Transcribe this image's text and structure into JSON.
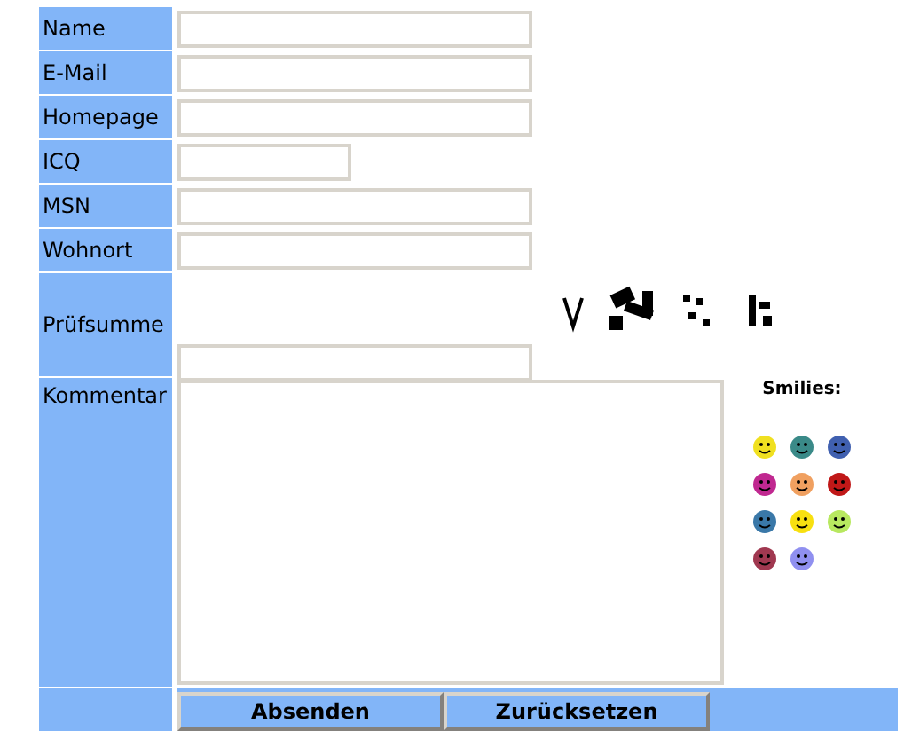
{
  "fields": [
    {
      "label": "Name",
      "kind": "text"
    },
    {
      "label": "E-Mail",
      "kind": "text"
    },
    {
      "label": "Homepage",
      "kind": "text"
    },
    {
      "label": "ICQ",
      "kind": "short"
    },
    {
      "label": "MSN",
      "kind": "text"
    },
    {
      "label": "Wohnort",
      "kind": "text"
    },
    {
      "label": "Prüfsumme",
      "kind": "captcha"
    }
  ],
  "comment": {
    "label": "Kommentar"
  },
  "smilies": {
    "title": "Smilies:",
    "items": [
      {
        "color": "#f0e020"
      },
      {
        "color": "#3a8a88"
      },
      {
        "color": "#4060b0"
      },
      {
        "color": "#c02890"
      },
      {
        "color": "#f0a060"
      },
      {
        "color": "#c01818"
      },
      {
        "color": "#3a78a8"
      },
      {
        "color": "#f8e010"
      },
      {
        "color": "#b8e860"
      },
      {
        "color": "#a03850"
      },
      {
        "color": "#9090f0"
      }
    ]
  },
  "buttons": [
    "Absenden",
    "Zurücksetzen"
  ]
}
